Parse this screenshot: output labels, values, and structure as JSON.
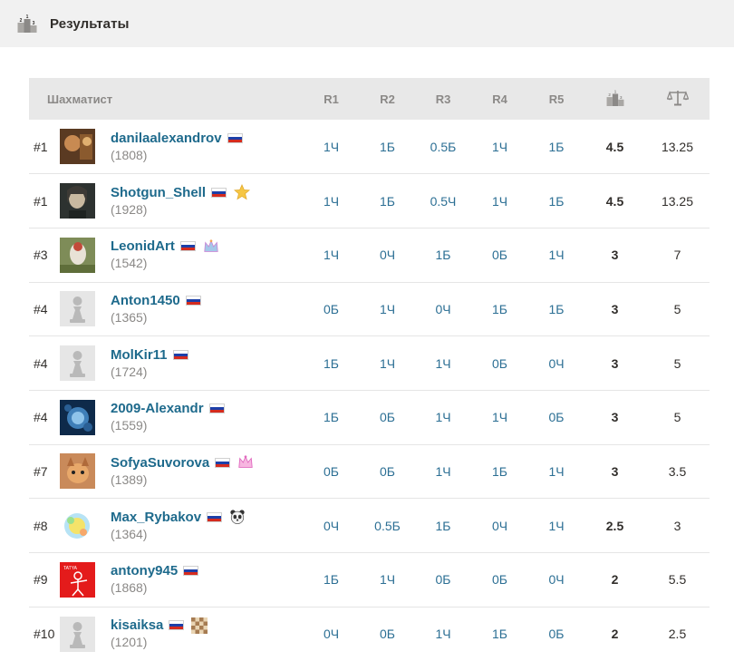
{
  "header": {
    "title": "Результаты",
    "icon": "podium-icon"
  },
  "table": {
    "columns": {
      "player": "Шахматист",
      "r1": "R1",
      "r2": "R2",
      "r3": "R3",
      "r4": "R4",
      "r5": "R5",
      "score_icon": "podium-icon",
      "tiebreak_icon": "scales-icon"
    },
    "rows": [
      {
        "rank": "#1",
        "name": "danilaalexandrov",
        "rating": "(1808)",
        "badge": "",
        "avatar": "photo-avatar",
        "r": [
          "1Ч",
          "1Б",
          "0.5Б",
          "1Ч",
          "1Б"
        ],
        "score": "4.5",
        "tiebreak": "13.25"
      },
      {
        "rank": "#1",
        "name": "Shotgun_Shell",
        "rating": "(1928)",
        "badge": "star-icon",
        "avatar": "photo-avatar",
        "r": [
          "1Ч",
          "1Б",
          "0.5Ч",
          "1Ч",
          "1Б"
        ],
        "score": "4.5",
        "tiebreak": "13.25"
      },
      {
        "rank": "#3",
        "name": "LeonidArt",
        "rating": "(1542)",
        "badge": "crown-icon",
        "avatar": "photo-avatar",
        "r": [
          "1Ч",
          "0Ч",
          "1Б",
          "0Б",
          "1Ч"
        ],
        "score": "3",
        "tiebreak": "7"
      },
      {
        "rank": "#4",
        "name": "Anton1450",
        "rating": "(1365)",
        "badge": "",
        "avatar": "pawn-avatar",
        "r": [
          "0Б",
          "1Ч",
          "0Ч",
          "1Б",
          "1Б"
        ],
        "score": "3",
        "tiebreak": "5"
      },
      {
        "rank": "#4",
        "name": "MolKir11",
        "rating": "(1724)",
        "badge": "",
        "avatar": "pawn-avatar",
        "r": [
          "1Б",
          "1Ч",
          "1Ч",
          "0Б",
          "0Ч"
        ],
        "score": "3",
        "tiebreak": "5"
      },
      {
        "rank": "#4",
        "name": "2009-Alexandr",
        "rating": "(1559)",
        "badge": "",
        "avatar": "photo-avatar",
        "r": [
          "1Б",
          "0Б",
          "1Ч",
          "1Ч",
          "0Б"
        ],
        "score": "3",
        "tiebreak": "5"
      },
      {
        "rank": "#7",
        "name": "SofyaSuvorova",
        "rating": "(1389)",
        "badge": "crown-pink-icon",
        "avatar": "photo-avatar",
        "r": [
          "0Б",
          "0Б",
          "1Ч",
          "1Б",
          "1Ч"
        ],
        "score": "3",
        "tiebreak": "3.5"
      },
      {
        "rank": "#8",
        "name": "Max_Rybakov",
        "rating": "(1364)",
        "badge": "panda-icon",
        "avatar": "photo-avatar",
        "r": [
          "0Ч",
          "0.5Б",
          "1Б",
          "0Ч",
          "1Ч"
        ],
        "score": "2.5",
        "tiebreak": "3"
      },
      {
        "rank": "#9",
        "name": "antony945",
        "rating": "(1868)",
        "badge": "",
        "avatar": "photo-avatar",
        "r": [
          "1Б",
          "1Ч",
          "0Б",
          "0Б",
          "0Ч"
        ],
        "score": "2",
        "tiebreak": "5.5"
      },
      {
        "rank": "#10",
        "name": "kisaiksa",
        "rating": "(1201)",
        "badge": "chessboard-icon",
        "avatar": "pawn-avatar",
        "r": [
          "0Ч",
          "0Б",
          "1Ч",
          "1Б",
          "0Б"
        ],
        "score": "2",
        "tiebreak": "2.5"
      }
    ]
  },
  "colors": {
    "link": "#1e6a8c",
    "round": "#2c6f94",
    "header_bg": "#e8e8e8",
    "topbar_bg": "#f1f1f1"
  }
}
